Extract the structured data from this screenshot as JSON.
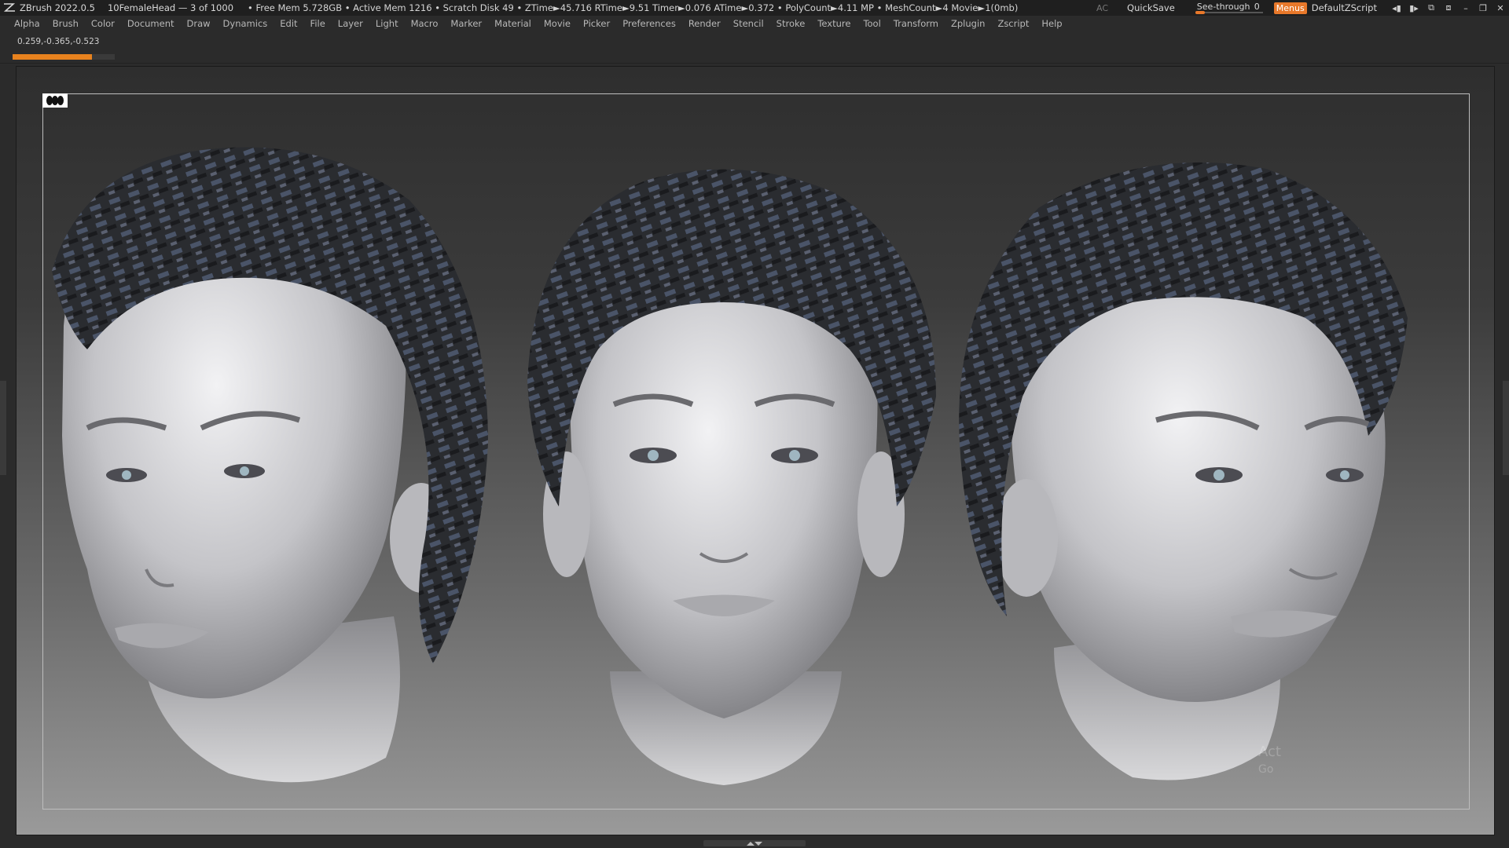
{
  "titlebar": {
    "app": "ZBrush 2022.0.5",
    "project": "10FemaleHead — 3 of 1000",
    "stats": "• Free Mem 5.728GB • Active Mem 1216 • Scratch Disk 49 • ZTime►45.716 RTime►9.51 Timer►0.076 ATime►0.372 • PolyCount►4.11 MP • MeshCount►4 Movie►1(0mb)",
    "ac": "AC",
    "quicksave": "QuickSave",
    "seethrough_label": "See-through",
    "seethrough_value": "0",
    "menus": "Menus",
    "zscript": "DefaultZScript"
  },
  "menubar": [
    "Alpha",
    "Brush",
    "Color",
    "Document",
    "Draw",
    "Dynamics",
    "Edit",
    "File",
    "Layer",
    "Light",
    "Macro",
    "Marker",
    "Material",
    "Movie",
    "Picker",
    "Preferences",
    "Render",
    "Stencil",
    "Stroke",
    "Texture",
    "Tool",
    "Transform",
    "Zplugin",
    "Zscript",
    "Help"
  ],
  "coords": "0.259,-0.365,-0.523",
  "progress": 0.78,
  "watermark": {
    "line1": "Act",
    "line2": "Go"
  },
  "colors": {
    "accent": "#e8782a",
    "progress": "#e8821e",
    "titlebar": "#1f1f1f"
  },
  "icons": [
    "zbrush-logo-icon",
    "minimize-icon",
    "restore-icon",
    "close-icon",
    "perspective-icon"
  ]
}
